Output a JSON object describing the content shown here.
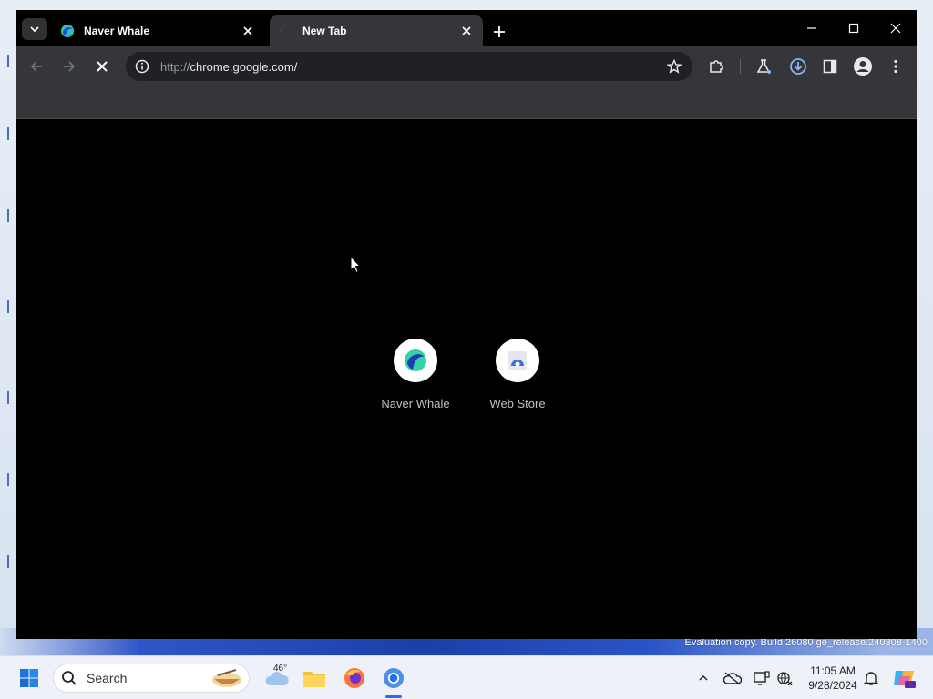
{
  "browser": {
    "tabs": [
      {
        "title": "Naver Whale",
        "state": "inactive"
      },
      {
        "title": "New Tab",
        "state": "active"
      }
    ],
    "address_bar": {
      "scheme": "http://",
      "host": "chrome.google.com/",
      "loading": true
    },
    "shortcuts": [
      {
        "label": "Naver Whale",
        "icon": "naver-whale-icon"
      },
      {
        "label": "Web Store",
        "icon": "web-store-icon"
      }
    ],
    "colors": {
      "toolbar": "#35363a",
      "content": "#000000",
      "accent": "#8ab4f8"
    }
  },
  "desktop": {
    "watermark_line1": "Evaluation copy. Build 26080.ge_release.240308-1400"
  },
  "taskbar": {
    "search_label": "Search",
    "weather_temp": "46°",
    "time": "11:05 AM",
    "date": "9/28/2024"
  }
}
